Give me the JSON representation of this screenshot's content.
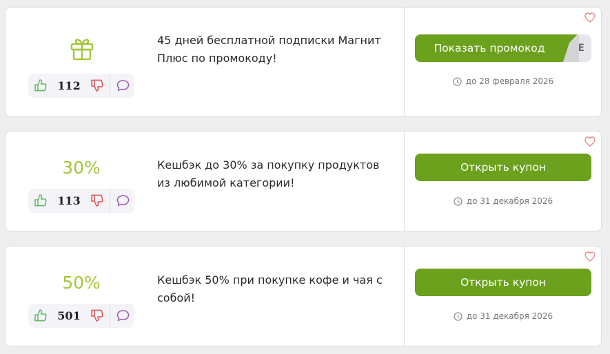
{
  "colors": {
    "accent_green": "#6ba11c",
    "badge_green": "#a4c639",
    "like": "#5cb85c",
    "dislike": "#e05050",
    "comment": "#9b59b6",
    "fav": "#e07a7a"
  },
  "offers": [
    {
      "badge_type": "gift-icon",
      "badge_text": "",
      "votes": "112",
      "description": "45 дней бесплатной подписки Магнит Плюс по промокоду!",
      "button_label": "Показать промокод",
      "code_peek": "E",
      "expiry": "до 28 февраля 2026"
    },
    {
      "badge_type": "percent",
      "badge_text": "30%",
      "votes": "113",
      "description": "Кешбэк до 30% за покупку продуктов из любимой категории!",
      "button_label": "Открыть купон",
      "expiry": "до 31 декабря 2026"
    },
    {
      "badge_type": "percent",
      "badge_text": "50%",
      "votes": "501",
      "description": "Кешбэк 50% при покупке кофе и чая с собой!",
      "button_label": "Открыть купон",
      "expiry": "до 31 декабря 2026"
    }
  ]
}
